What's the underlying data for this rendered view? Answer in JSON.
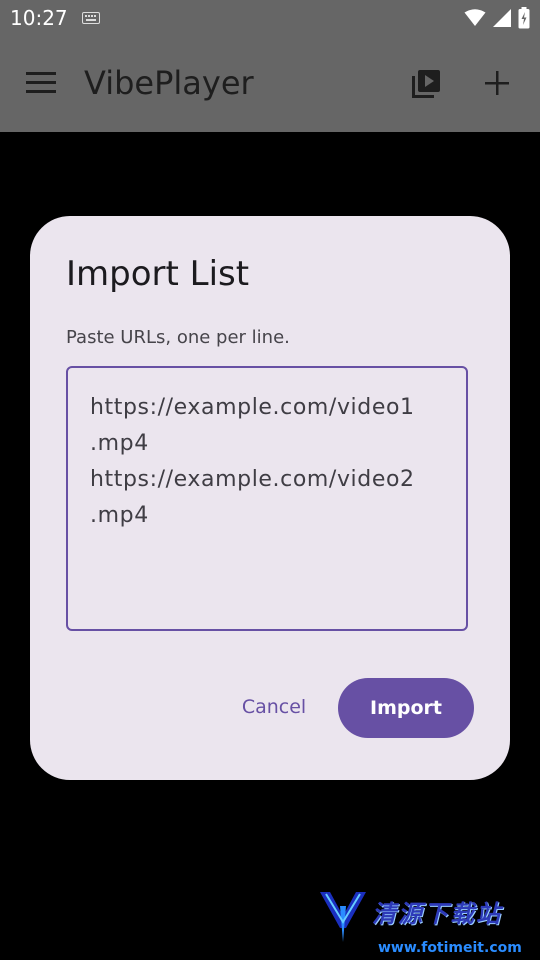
{
  "status_bar": {
    "time": "10:27",
    "icons": [
      "keyboard-icon",
      "wifi-icon",
      "signal-icon",
      "battery-charging-icon"
    ]
  },
  "app_bar": {
    "title": "VibePlayer",
    "icons": [
      "menu-icon",
      "playlist-icon",
      "add-icon"
    ]
  },
  "dialog": {
    "title": "Import List",
    "description": "Paste URLs, one per line.",
    "url_field_value": "https://example.com/video1\n.mp4\nhttps://example.com/video2\n.mp4",
    "cancel_label": "Cancel",
    "import_label": "Import",
    "accent_color": "#6750a4",
    "surface_color": "#ebe5ee"
  },
  "watermark": {
    "name": "清源下载站",
    "url": "www.fotimeit.com"
  }
}
